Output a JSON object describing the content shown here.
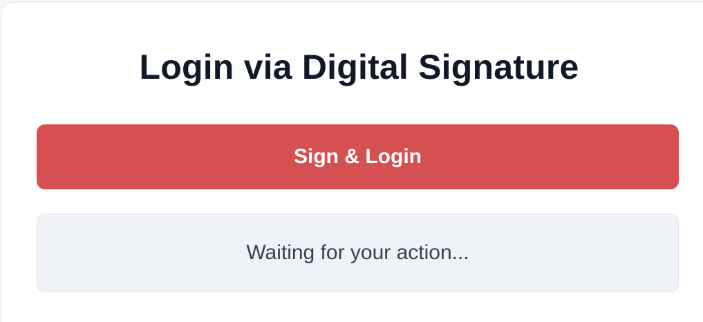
{
  "login": {
    "title": "Login via Digital Signature",
    "button_label": "Sign & Login",
    "status_text": "Waiting for your action..."
  },
  "colors": {
    "button_bg": "#d65052",
    "status_bg": "#eff2f7"
  }
}
